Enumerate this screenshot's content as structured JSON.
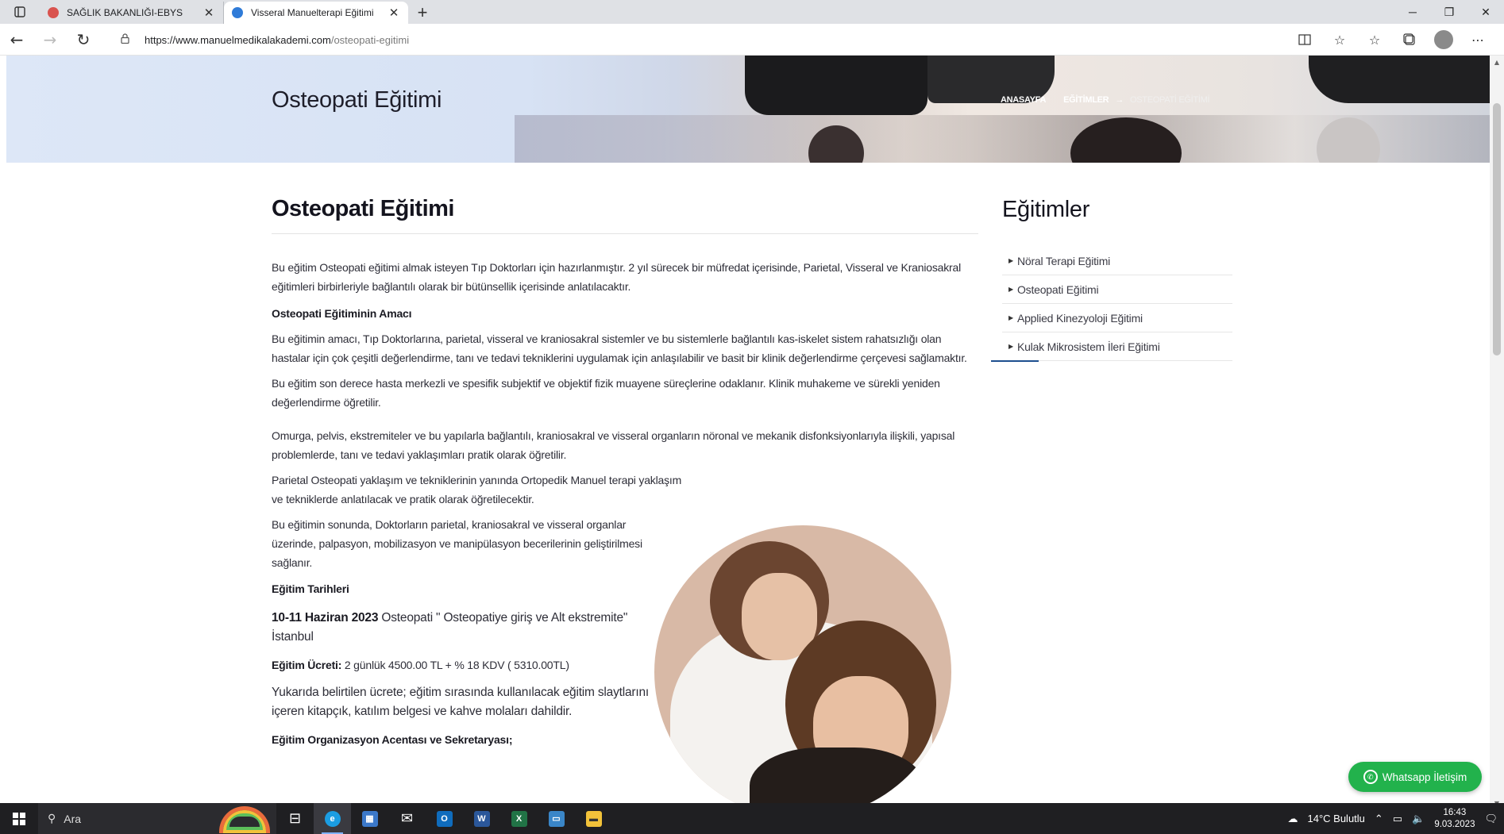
{
  "browser": {
    "tabs": [
      {
        "title": "SAĞLIK BAKANLIĞI-EBYS",
        "favicon_color": "#d9534f",
        "active": false
      },
      {
        "title": "Visseral Manuelterapi Eğitimi",
        "favicon_color": "#2f7bd8",
        "active": true
      }
    ],
    "url_host": "https://www.manuelmedikalakademi.com",
    "url_path": "/osteopati-egitimi"
  },
  "hero": {
    "title": "Osteopati Eğitimi",
    "breadcrumb": [
      "ANASAYFA",
      "EĞİTİMLER",
      "OSTEOPATİ EĞİTİMİ"
    ],
    "breadcrumb_sep": "→"
  },
  "article": {
    "title": "Osteopati Eğitimi",
    "intro": "Bu eğitim Osteopati  eğitimi almak isteyen Tıp Doktorları için hazırlanmıştır. 2 yıl sürecek bir müfredat içerisinde, Parietal, Visseral  ve Kraniosakral eğitimleri birbirleriyle bağlantılı olarak bir bütünsellik içerisinde anlatılacaktır.",
    "aim_heading": "Osteopati Eğitiminin Amacı",
    "aim_p1": "Bu eğitimin amacı, Tıp Doktorlarına, parietal, visseral ve kraniosakral sistemler ve bu sistemlerle bağlantılı kas-iskelet sistem rahatsızlığı olan hastalar için çok çeşitli değerlendirme, tanı ve tedavi tekniklerini uygulamak için anlaşılabilir ve basit bir klinik değerlendirme çerçevesi sağlamaktır.",
    "aim_p2": "Bu eğitim son derece hasta merkezli ve spesifik subjektif ve objektif fizik muayene süreçlerine odaklanır. Klinik muhakeme ve sürekli yeniden değerlendirme öğretilir.",
    "p3": "Omurga, pelvis, ekstremiteler ve bu yapılarla bağlantılı, kraniosakral ve visseral organların nöronal ve mekanik disfonksiyonlarıyla ilişkili, yapısal problemlerde, tanı ve tedavi yaklaşımları pratik olarak öğretilir.",
    "p4": "Parietal Osteopati yaklaşım ve tekniklerinin yanında Ortopedik Manuel terapi yaklaşım ve tekniklerde anlatılacak ve pratik olarak öğretilecektir.",
    "p5": "Bu eğitimin sonunda, Doktorların parietal, kraniosakral ve visseral organlar üzerinde, palpasyon, mobilizasyon ve manipülasyon becerilerinin geliştirilmesi sağlanır.",
    "dates_heading": "Eğitim Tarihleri",
    "date_bold": "10-11 Haziran 2023",
    "date_text": " Osteopati \" Osteopatiye giriş ve Alt ekstremite\" İstanbul",
    "fee_label": "Eğitim Ücreti:",
    "fee_text": " 2 günlük 4500.00 TL + % 18 KDV ( 5310.00TL)",
    "includes": "Yukarıda belirtilen ücrete; eğitim sırasında kullanılacak eğitim slaytlarını içeren kitapçık, katılım belgesi ve kahve molaları dahildir.",
    "org_heading": "Eğitim Organizasyon Acentası ve Sekretaryası;"
  },
  "sidebar": {
    "title": "Eğitimler",
    "items": [
      "Nöral Terapi Eğitimi",
      "Osteopati Eğitimi",
      "Applied Kinezyoloji Eğitimi",
      "Kulak Mikrosistem İleri Eğitimi"
    ]
  },
  "whatsapp": {
    "label": "Whatsapp İletişim",
    "color": "#22b24c"
  },
  "taskbar": {
    "search_label": "Ara",
    "weather": "14°C  Bulutlu",
    "time": "16:43",
    "date": "9.03.2023"
  }
}
